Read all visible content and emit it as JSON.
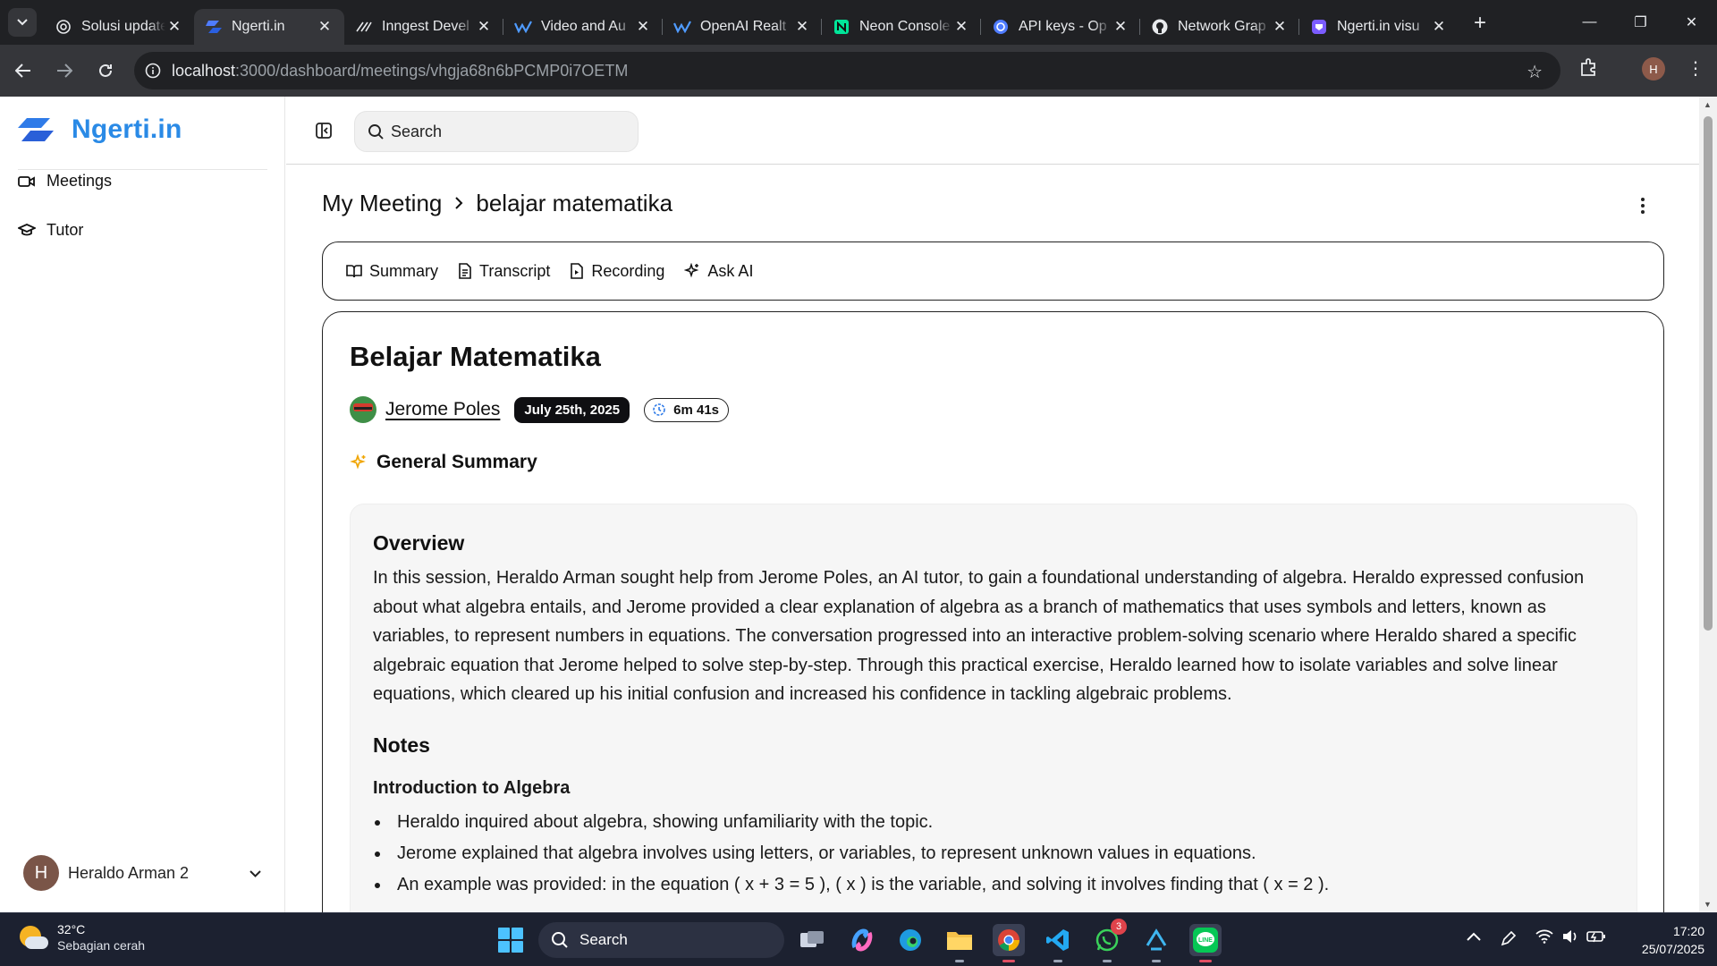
{
  "browser": {
    "tabs": [
      {
        "label": "Solusi update",
        "active": false
      },
      {
        "label": "Ngerti.in",
        "active": true
      },
      {
        "label": "Inngest Devel",
        "active": false
      },
      {
        "label": "Video and Au",
        "active": false
      },
      {
        "label": "OpenAI Realt",
        "active": false
      },
      {
        "label": "Neon Console",
        "active": false
      },
      {
        "label": "API keys - Op",
        "active": false
      },
      {
        "label": "Network Grap",
        "active": false
      },
      {
        "label": "Ngerti.in visu",
        "active": false
      }
    ],
    "url_host": "localhost",
    "url_rest": ":3000/dashboard/meetings/vhgja68n6bPCMP0i7OETM",
    "profile_initial": "H"
  },
  "sidebar": {
    "brand": "Ngerti.in",
    "items": [
      {
        "label": "Meetings",
        "icon": "video-icon"
      },
      {
        "label": "Tutor",
        "icon": "graduation-cap-icon"
      }
    ],
    "user": {
      "initial": "H",
      "name": "Heraldo Arman 2"
    }
  },
  "topbar": {
    "search_placeholder": "Search"
  },
  "breadcrumb": {
    "root": "My Meeting",
    "current": "belajar matematika"
  },
  "tabs": [
    {
      "label": "Summary",
      "icon": "book-open-icon"
    },
    {
      "label": "Transcript",
      "icon": "file-text-icon"
    },
    {
      "label": "Recording",
      "icon": "file-video-icon"
    },
    {
      "label": "Ask AI",
      "icon": "sparkles-icon"
    }
  ],
  "meeting": {
    "title": "Belajar Matematika",
    "agent": "Jerome Poles",
    "date": "July 25th, 2025",
    "duration": "6m 41s",
    "section_label": "General Summary"
  },
  "summary": {
    "overview_heading": "Overview",
    "overview": "In this session, Heraldo Arman sought help from Jerome Poles, an AI tutor, to gain a foundational understanding of algebra. Heraldo expressed confusion about what algebra entails, and Jerome provided a clear explanation of algebra as a branch of mathematics that uses symbols and letters, known as variables, to represent numbers in equations. The conversation progressed into an interactive problem-solving scenario where Heraldo shared a specific algebraic equation that Jerome helped to solve step-by-step. Through this practical exercise, Heraldo learned how to isolate variables and solve linear equations, which cleared up his initial confusion and increased his confidence in tackling algebraic problems.",
    "notes_heading": "Notes",
    "notes_subheading": "Introduction to Algebra",
    "notes": [
      "Heraldo inquired about algebra, showing unfamiliarity with the topic.",
      "Jerome explained that algebra involves using letters, or variables, to represent unknown values in equations.",
      "An example was provided: in the equation ( x + 3 = 5 ), ( x ) is the variable, and solving it involves finding that ( x = 2 )."
    ]
  },
  "taskbar": {
    "weather_temp": "32°C",
    "weather_cond": "Sebagian cerah",
    "search_label": "Search",
    "whatsapp_badge": "3",
    "time": "17:20",
    "date": "25/07/2025"
  },
  "colors": {
    "brand": "#2a8ae6",
    "chrome_dark": "#202124",
    "chrome_toolbar": "#35363a",
    "taskbar": "#1c2130"
  }
}
